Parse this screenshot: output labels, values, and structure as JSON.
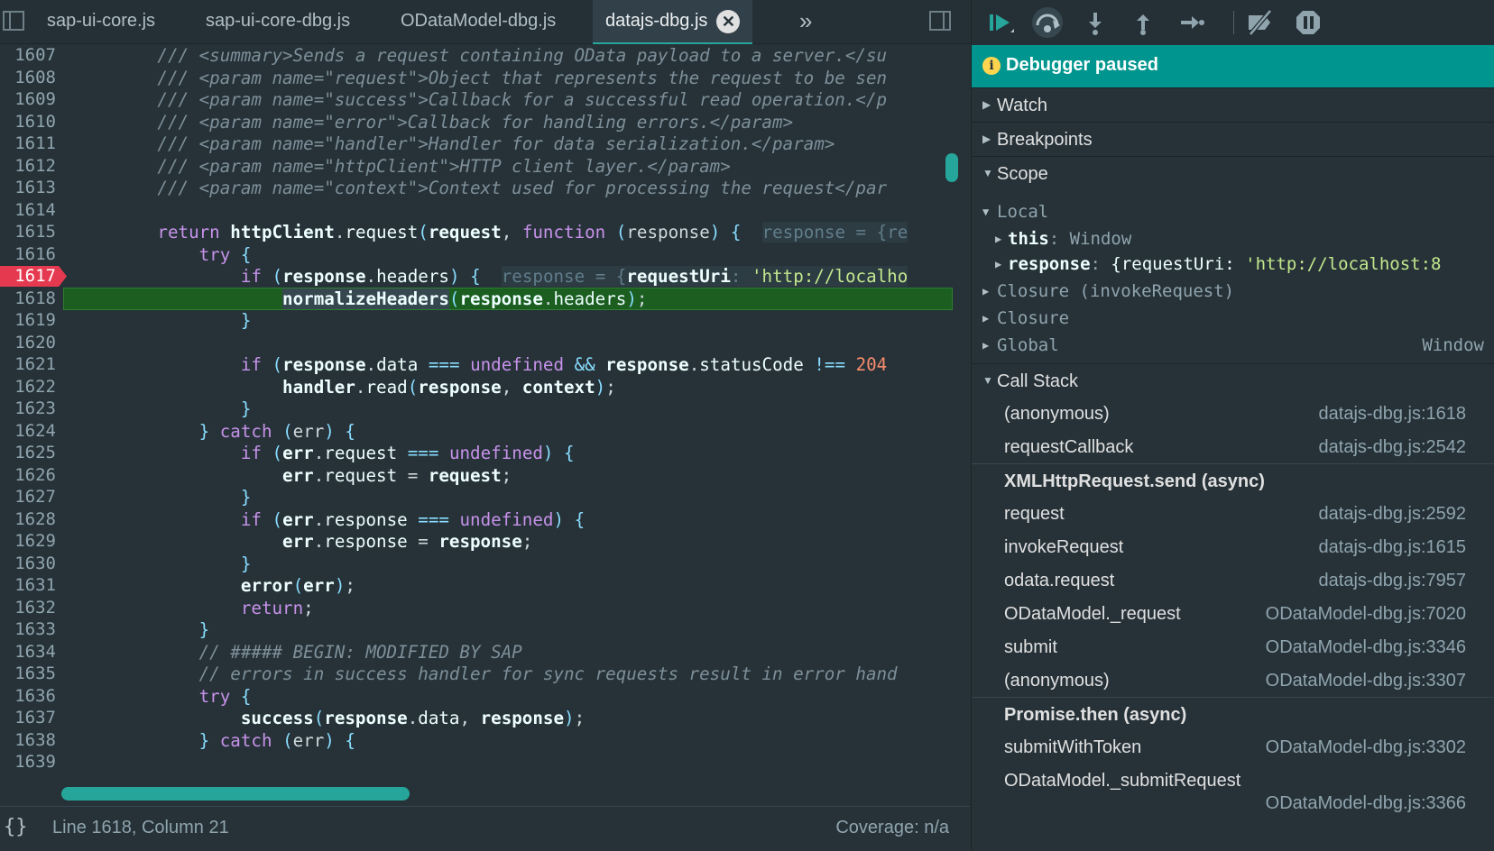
{
  "tabs": [
    {
      "label": "sap-ui-core.js"
    },
    {
      "label": "sap-ui-core-dbg.js"
    },
    {
      "label": "ODataModel-dbg.js"
    },
    {
      "label": "datajs-dbg.js",
      "active": true
    }
  ],
  "tab_close": "✕",
  "tab_more": "»",
  "code": {
    "line_numbers": [
      "1607",
      "1608",
      "1609",
      "1610",
      "1611",
      "1612",
      "1613",
      "1614",
      "1615",
      "1616",
      "1617",
      "1618",
      "1619",
      "1620",
      "1621",
      "1622",
      "1623",
      "1624",
      "1625",
      "1626",
      "1627",
      "1628",
      "1629",
      "1630",
      "1631",
      "1632",
      "1633",
      "1634",
      "1635",
      "1636",
      "1637",
      "1638",
      "1639"
    ],
    "breakpoint_line": "1617",
    "current_line": "1618",
    "lines": {
      "l1607": "/// <summary>Sends a request containing OData payload to a server.</su",
      "l1608": "/// <param name=\"request\">Object that represents the request to be sen",
      "l1609": "/// <param name=\"success\">Callback for a successful read operation.</p",
      "l1610": "/// <param name=\"error\">Callback for handling errors.</param>",
      "l1611": "/// <param name=\"handler\">Handler for data serialization.</param>",
      "l1612": "/// <param name=\"httpClient\">HTTP client layer.</param>",
      "l1613": "/// <param name=\"context\">Context used for processing the request</par",
      "l1634": "// ##### BEGIN: MODIFIED BY SAP",
      "l1635": "// errors in success handler for sync requests result in error hand"
    },
    "inline_1615": "response = {re",
    "inline_1617_key": "response = {",
    "inline_1617_a": "requestUri",
    "inline_1617_b": ": ",
    "inline_1617_c": "'http://localho"
  },
  "status": {
    "braces": "{}",
    "position": "Line 1618, Column 21",
    "coverage": "Coverage: n/a"
  },
  "debugger": {
    "paused_text": "Debugger paused",
    "info_icon": "i",
    "watch": "Watch",
    "breakpoints": "Breakpoints",
    "scope": "Scope",
    "local": "Local",
    "this_key": "this",
    "this_val": "Window",
    "response_key": "response",
    "response_val_a": "{requestUri: ",
    "response_val_b": "'http://localhost:8",
    "closure_invoke": "Closure (invokeRequest)",
    "closure": "Closure",
    "global": "Global",
    "global_val": "Window",
    "call_stack": "Call Stack",
    "frames": [
      {
        "fn": "(anonymous)",
        "loc": "datajs-dbg.js:1618"
      },
      {
        "fn": "requestCallback",
        "loc": "datajs-dbg.js:2542"
      },
      {
        "fn": "XMLHttpRequest.send (async)",
        "loc": ""
      },
      {
        "fn": "request",
        "loc": "datajs-dbg.js:2592"
      },
      {
        "fn": "invokeRequest",
        "loc": "datajs-dbg.js:1615"
      },
      {
        "fn": "odata.request",
        "loc": "datajs-dbg.js:7957"
      },
      {
        "fn": "ODataModel._request",
        "loc": "ODataModel-dbg.js:7020"
      },
      {
        "fn": "submit",
        "loc": "ODataModel-dbg.js:3346"
      },
      {
        "fn": "(anonymous)",
        "loc": "ODataModel-dbg.js:3307"
      },
      {
        "fn": "Promise.then (async)",
        "loc": ""
      },
      {
        "fn": "submitWithToken",
        "loc": "ODataModel-dbg.js:3302"
      },
      {
        "fn": "ODataModel._submitRequest",
        "loc": ""
      },
      {
        "fn": "",
        "loc": "ODataModel-dbg.js:3366"
      }
    ]
  },
  "colors": {
    "accent": "#26a69a",
    "paused_bar": "#00968f",
    "breakpoint": "#e53950",
    "current_line": "#1b5e20"
  }
}
